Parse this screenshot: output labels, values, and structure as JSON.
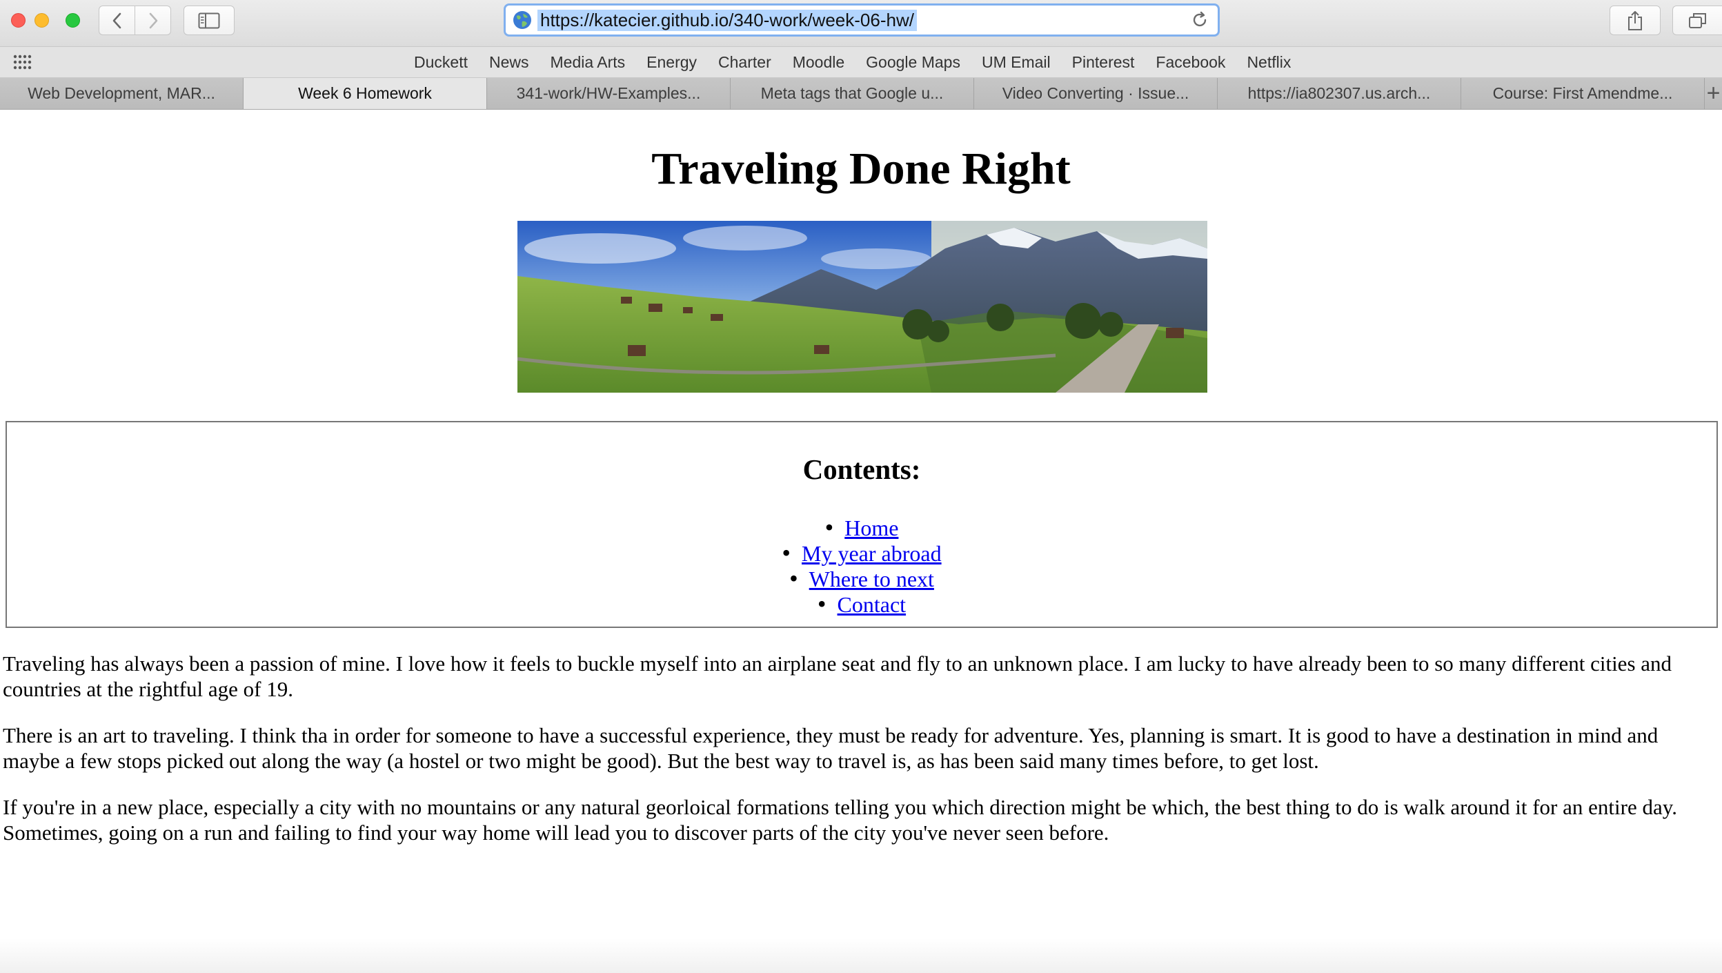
{
  "browser": {
    "url": "https://katecier.github.io/340-work/week-06-hw/",
    "favorites": [
      "Duckett",
      "News",
      "Media Arts",
      "Energy",
      "Charter",
      "Moodle",
      "Google Maps",
      "UM Email",
      "Pinterest",
      "Facebook",
      "Netflix"
    ],
    "tabs": [
      {
        "label": "Web Development, MAR...",
        "active": false
      },
      {
        "label": "Week 6 Homework",
        "active": true
      },
      {
        "label": "341-work/HW-Examples...",
        "active": false
      },
      {
        "label": "Meta tags that Google u...",
        "active": false
      },
      {
        "label": "Video Converting · Issue...",
        "active": false
      },
      {
        "label": "https://ia802307.us.arch...",
        "active": false
      },
      {
        "label": "Course: First Amendme...",
        "active": false
      }
    ],
    "new_tab_glyph": "+",
    "icons": {
      "back": "chevron-left-icon",
      "forward": "chevron-right-icon",
      "sidebar": "sidebar-icon",
      "share": "share-icon",
      "tabs_overview": "tabs-overview-icon",
      "site": "globe-icon",
      "reload": "reload-icon",
      "favorites_grid": "grid-icon"
    }
  },
  "page": {
    "title": "Traveling Done Right",
    "hero_image": "mountain village panorama",
    "contents_heading": "Contents:",
    "toc": [
      "Home",
      "My year abroad",
      "Where to next",
      "Contact"
    ],
    "paragraphs": [
      "Traveling has always been a passion of mine. I love how it feels to buckle myself into an airplane seat and fly to an unknown place. I am lucky to have already been to so many different cities and countries at the rightful age of 19.",
      "There is an art to traveling. I think tha in order for someone to have a successful experience, they must be ready for adventure. Yes, planning is smart. It is good to have a destination in mind and maybe a few stops picked out along the way (a hostel or two might be good). But the best way to travel is, as has been said many times before, to get lost.",
      "If you're in a new place, especially a city with no mountains or any natural georloical formations telling you which direction might be which, the best thing to do is walk around it for an entire day. Sometimes, going on a run and failing to find your way home will lead you to discover parts of the city you've never seen before."
    ],
    "link_color": "#0000ee"
  }
}
